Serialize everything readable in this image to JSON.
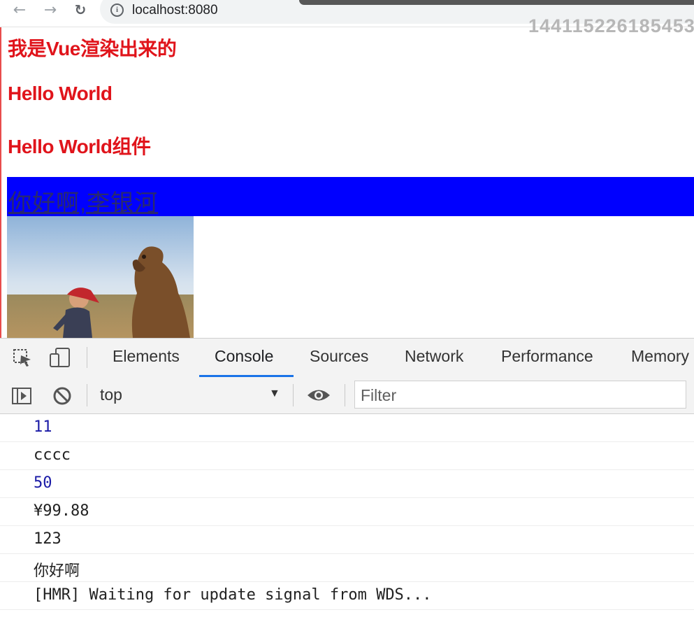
{
  "browser": {
    "url": "localhost:8080",
    "watermark": "144115226185453"
  },
  "page": {
    "heading1": "我是Vue渲染出来的",
    "heading2": "Hello World",
    "heading3": "Hello World组件",
    "link_text": "你好啊,李银河",
    "colors": {
      "heading": "#e0141b",
      "banner": "#0000ff"
    }
  },
  "devtools": {
    "tabs": [
      "Elements",
      "Console",
      "Sources",
      "Network",
      "Performance",
      "Memory"
    ],
    "active_tab": "Console",
    "context": "top",
    "filter_placeholder": "Filter",
    "console_lines": [
      {
        "text": "11",
        "type": "number"
      },
      {
        "text": "cccc",
        "type": "string"
      },
      {
        "text": "50",
        "type": "number"
      },
      {
        "text": "¥99.88",
        "type": "string"
      },
      {
        "text": "123",
        "type": "string"
      },
      {
        "text": "你好啊",
        "type": "string"
      },
      {
        "text": "[HMR] Waiting for update signal from WDS...",
        "type": "string"
      }
    ]
  }
}
